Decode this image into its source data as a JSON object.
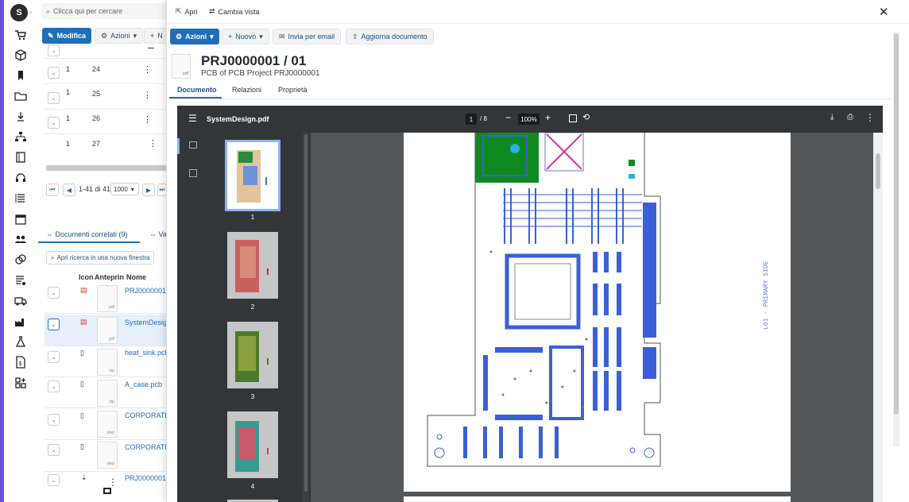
{
  "bg_page": {
    "search_placeholder": "Clicca qui per cercare",
    "toolbar": {
      "modifica": "Modifica",
      "azioni": "Azioni",
      "nuovo_partial": "N"
    },
    "bom_rows": [
      {
        "qty": "1",
        "pos": "24"
      },
      {
        "qty": "1",
        "pos": "25"
      },
      {
        "qty": "1",
        "pos": "26"
      },
      {
        "qty": "1",
        "pos": "27"
      }
    ],
    "pagination": {
      "range": "1-41 di 41",
      "page_size": "1000"
    },
    "tabs": {
      "docs": "Documenti correlati (9)",
      "other_partial": "Va"
    },
    "open_search": "Apri ricerca in una nuova finestra",
    "table_headers": {
      "icon": "Icon",
      "preview": "Anteprin",
      "name": "Nome"
    },
    "doc_rows": [
      {
        "name": "PRJ0000001",
        "ext": "pdf"
      },
      {
        "name": "SystemDesig",
        "ext": "pdf"
      },
      {
        "name": "heat_sink.pcb",
        "ext": "stp"
      },
      {
        "name": "A_case.pcb",
        "ext": "stp"
      },
      {
        "name": "CORPORATE_",
        "ext": "step"
      },
      {
        "name": "CORPORATE.",
        "ext": "step"
      },
      {
        "name": "PRJ0000001",
        "ext": ""
      }
    ]
  },
  "panel": {
    "topbar": {
      "open": "Apri",
      "change_view": "Cambia vista"
    },
    "actions": {
      "azioni": "Azioni",
      "nuovo": "Nuovo",
      "email": "Invia per email",
      "update": "Aggiorna documento"
    },
    "doc": {
      "file_label": "pdf",
      "title": "PRJ0000001 / 01",
      "subtitle": "PCB of PCB Project PRJ0000001"
    },
    "tabs": [
      "Documento",
      "Relazioni",
      "Proprietà"
    ],
    "viewer": {
      "filename": "SystemDesign.pdf",
      "current_page": "1",
      "total_pages": "/ 8",
      "zoom": "100%",
      "thumbnails": [
        "1",
        "2",
        "3",
        "4"
      ],
      "page_side_label": "L01 - PRIMARY SIDE"
    }
  },
  "colors": {
    "accent": "#1f6fb8",
    "rail": "#6c4ee0",
    "viewer_dark": "#323639",
    "viewer_bg": "#525659"
  }
}
